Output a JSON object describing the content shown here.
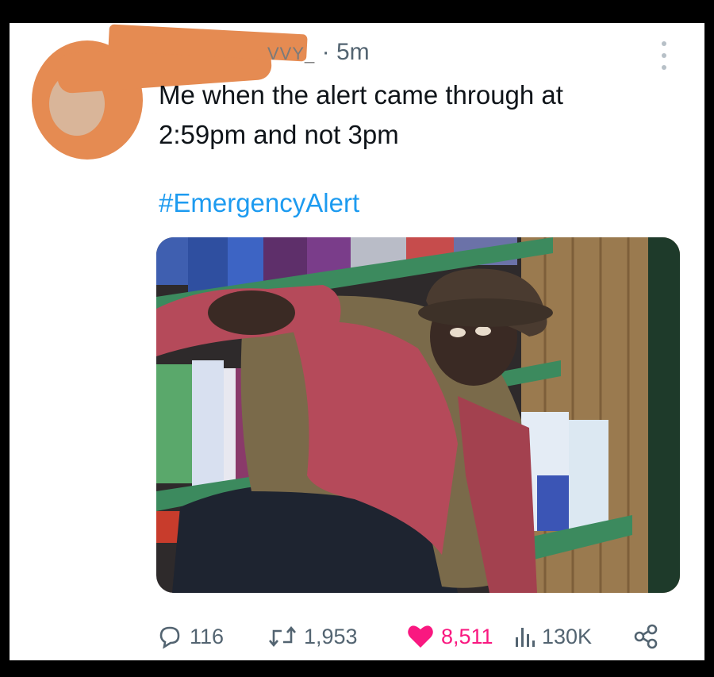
{
  "tweet": {
    "handle_fragment": "VVY_",
    "separator": "·",
    "time_ago": "5m",
    "text_line1": "Me when the alert came through at",
    "text_line2": "2:59pm and not 3pm",
    "hashtag": "#EmergencyAlert"
  },
  "actions": {
    "replies": "116",
    "retweets": "1,953",
    "likes": "8,511",
    "views": "130K"
  },
  "icons": [
    "more-icon",
    "reply-icon",
    "retweet-icon",
    "heart-icon",
    "views-icon",
    "share-icon"
  ],
  "colors": {
    "like": "#f91880",
    "hashtag": "#1d9bf0",
    "muted": "#536471",
    "redaction": "#e58b52"
  }
}
